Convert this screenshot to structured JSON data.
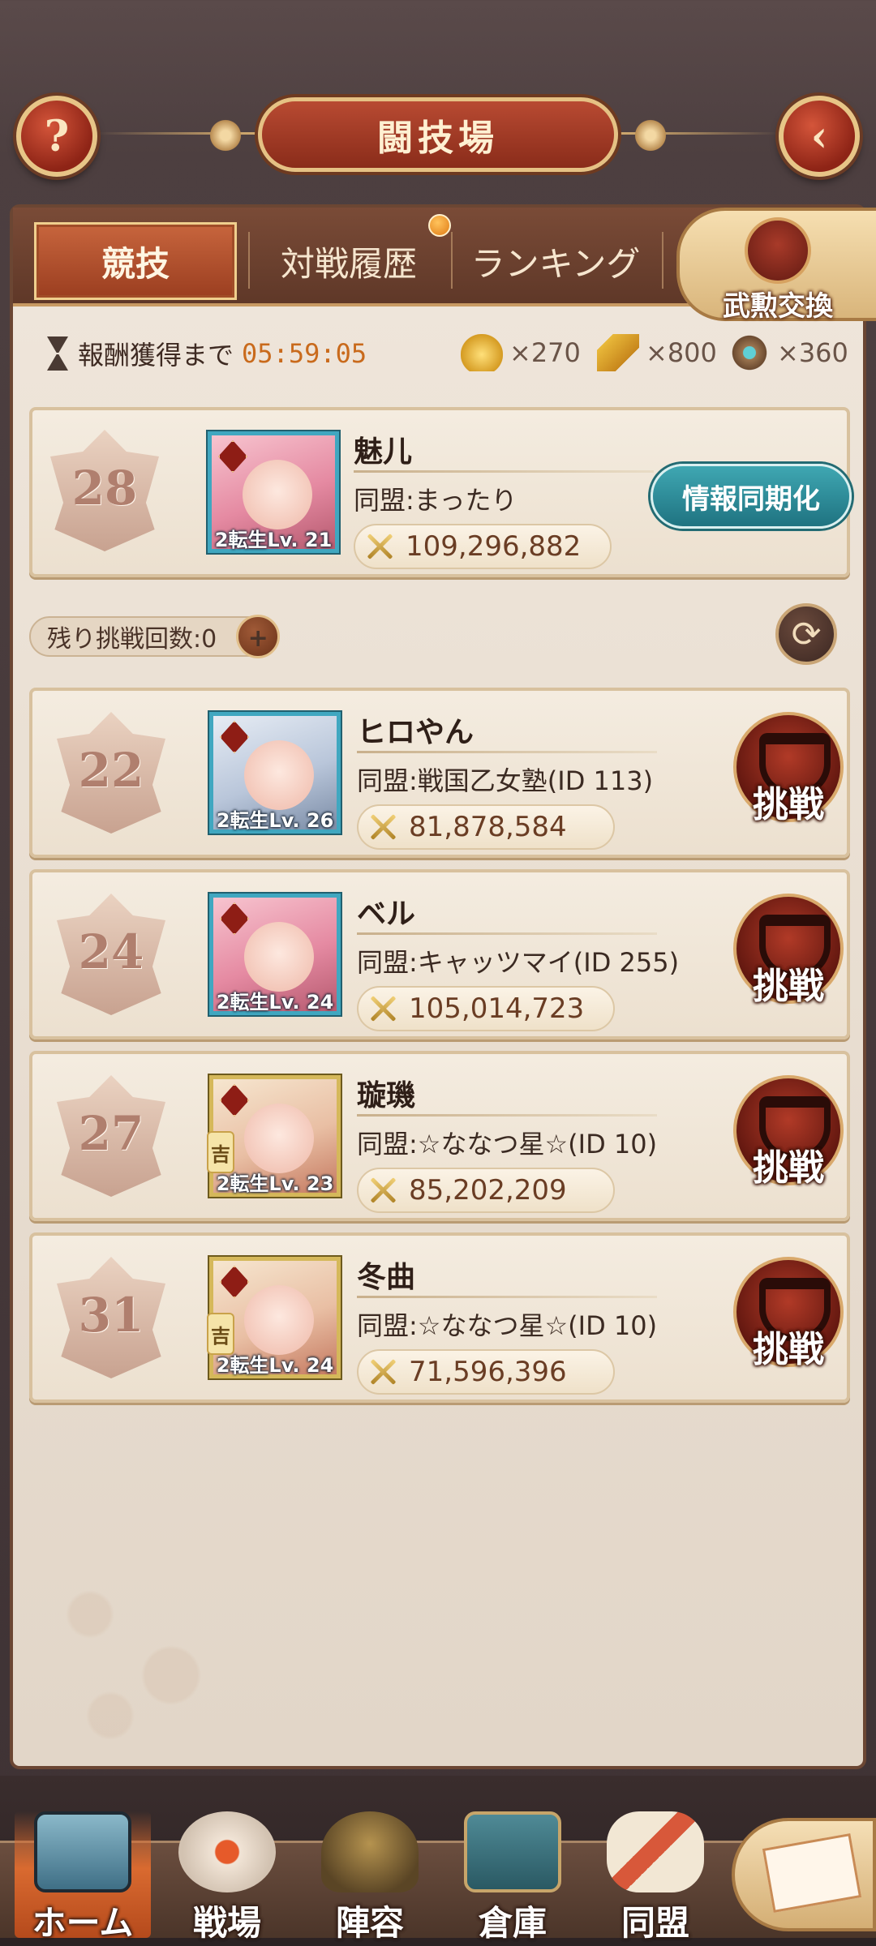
{
  "header": {
    "title": "闘技場",
    "help_icon": "?",
    "back_icon": "‹"
  },
  "tabs": [
    {
      "label": "競技",
      "active": true
    },
    {
      "label": "対戦履歴",
      "active": false
    },
    {
      "label": "ランキング",
      "active": false
    }
  ],
  "medal_exchange": {
    "label": "武勲交換"
  },
  "reward": {
    "label": "報酬獲得まで",
    "countdown": "05:59:05",
    "currencies": [
      {
        "icon": "gold-ingot-icon",
        "amount": "×270"
      },
      {
        "icon": "ticket-icon",
        "amount": "×800"
      },
      {
        "icon": "emblem-icon",
        "amount": "×360"
      }
    ]
  },
  "me": {
    "rank": "28",
    "name": "魅儿",
    "guild": "同盟:まったり",
    "power": "109,296,882",
    "level": "2転生Lv. 21",
    "sync_label": "情報同期化"
  },
  "attempts": {
    "label": "残り挑戦回数:0",
    "plus": "+"
  },
  "refresh_icon": "⟳",
  "opponents": [
    {
      "rank": "22",
      "name": "ヒロやん",
      "guild": "同盟:戦国乙女塾(ID 113)",
      "power": "81,878,584",
      "level": "2転生Lv. 26",
      "challenge_label": "挑戦"
    },
    {
      "rank": "24",
      "name": "ベル",
      "guild": "同盟:キャッツマイ(ID 255)",
      "power": "105,014,723",
      "level": "2転生Lv. 24",
      "challenge_label": "挑戦"
    },
    {
      "rank": "27",
      "name": "璇璣",
      "guild": "同盟:☆ななつ星☆(ID 10)",
      "power": "85,202,209",
      "level": "2転生Lv. 23",
      "challenge_label": "挑戦",
      "badge": "吉"
    },
    {
      "rank": "31",
      "name": "冬曲",
      "guild": "同盟:☆ななつ星☆(ID 10)",
      "power": "71,596,396",
      "level": "2転生Lv. 24",
      "challenge_label": "挑戦",
      "badge": "吉"
    }
  ],
  "nav": [
    {
      "label": "ホーム",
      "active": true
    },
    {
      "label": "戦場",
      "active": false
    },
    {
      "label": "陣容",
      "active": false
    },
    {
      "label": "倉庫",
      "active": false
    },
    {
      "label": "同盟",
      "active": false
    }
  ],
  "colors": {
    "accent_red": "#9b3e20",
    "countdown": "#c96a1c",
    "sync_button": "#1f7381"
  }
}
